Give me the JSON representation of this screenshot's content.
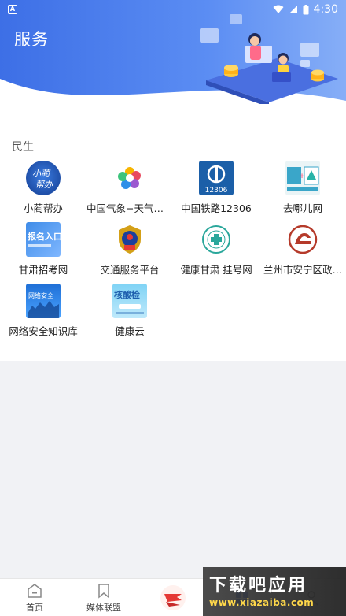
{
  "status_bar": {
    "time": "4:30",
    "notification_icon": "A"
  },
  "header": {
    "title": "服务"
  },
  "section": {
    "title": "民生",
    "items": [
      {
        "label": "小蔺帮办",
        "icon": "xiaolin-bangban-icon"
      },
      {
        "label": "中国气象−天气预…",
        "icon": "weather-flower-icon"
      },
      {
        "label": "中国铁路12306",
        "icon": "railway-12306-icon",
        "icon_text": "12306"
      },
      {
        "label": "去哪儿网",
        "icon": "qunar-icon"
      },
      {
        "label": "甘肃招考网",
        "icon": "gansu-exam-icon",
        "icon_text": "报名入口"
      },
      {
        "label": "交通服务平台",
        "icon": "police-emblem-icon"
      },
      {
        "label": "健康甘肃  挂号网",
        "icon": "health-gansu-icon"
      },
      {
        "label": "兰州市安宁区政…",
        "icon": "anning-district-icon"
      },
      {
        "label": "网络安全知识库",
        "icon": "cyber-security-icon",
        "icon_text": "网络安全"
      },
      {
        "label": "健康云",
        "icon": "health-cloud-icon",
        "icon_text": "核酸检"
      }
    ]
  },
  "tab_bar": {
    "tabs": [
      {
        "label": "首页",
        "icon": "home-icon"
      },
      {
        "label": "媒体联盟",
        "icon": "bookmark-icon"
      },
      {
        "label": "",
        "icon": "center-logo-icon"
      },
      {
        "label": "",
        "icon": "service-icon"
      },
      {
        "label": "",
        "icon": "user-icon"
      }
    ]
  },
  "watermark": {
    "title": "下载吧应用",
    "url": "www.xiazaiba.com"
  },
  "colors": {
    "header_start": "#3d6fe6",
    "header_end": "#86aef7",
    "accent": "#3d6fe6"
  }
}
